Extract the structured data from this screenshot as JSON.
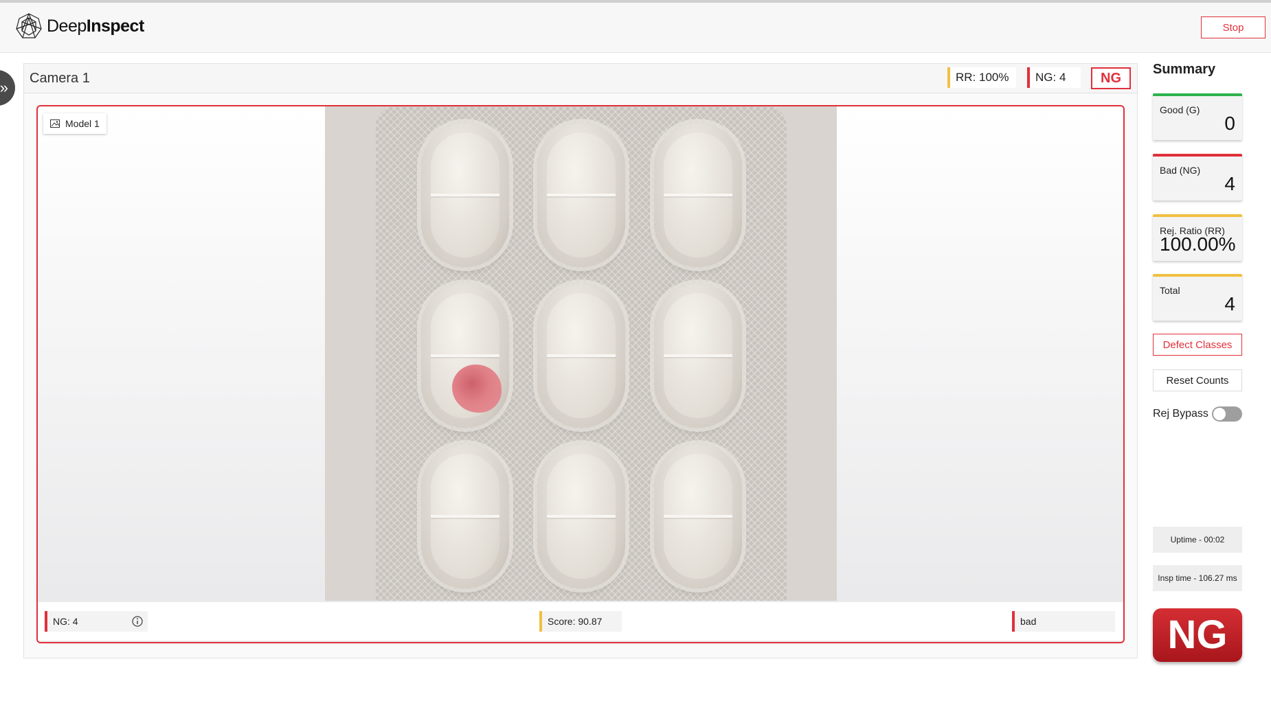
{
  "app": {
    "brand_light": "Deep",
    "brand_bold": "Inspect"
  },
  "header": {
    "stop_label": "Stop"
  },
  "camera": {
    "title": "Camera 1",
    "rr_chip": "RR: 100%",
    "ng_chip": "NG: 4",
    "status_badge": "NG",
    "model_label": "Model 1"
  },
  "result_bar": {
    "ng_text": "NG: 4",
    "score_text": "Score: 90.87",
    "label_text": "bad"
  },
  "summary": {
    "title": "Summary",
    "cards": [
      {
        "label": "Good (G)",
        "value": "0",
        "accent": "#2db34a"
      },
      {
        "label": "Bad (NG)",
        "value": "4",
        "accent": "#e0303a"
      },
      {
        "label": "Rej. Ratio (RR)",
        "value": "100.00%",
        "accent": "#f0c040"
      },
      {
        "label": "Total",
        "value": "4",
        "accent": "#f0c040"
      }
    ],
    "defect_classes_label": "Defect Classes",
    "reset_counts_label": "Reset Counts",
    "rej_bypass_label": "Rej Bypass",
    "rej_bypass_on": false,
    "uptime": "Uptime - 00:02",
    "insp_time": "Insp time - 106.27 ms",
    "final_result": "NG"
  },
  "colors": {
    "accent_red": "#e0303a",
    "accent_yellow": "#f0c040",
    "accent_green": "#2db34a"
  }
}
